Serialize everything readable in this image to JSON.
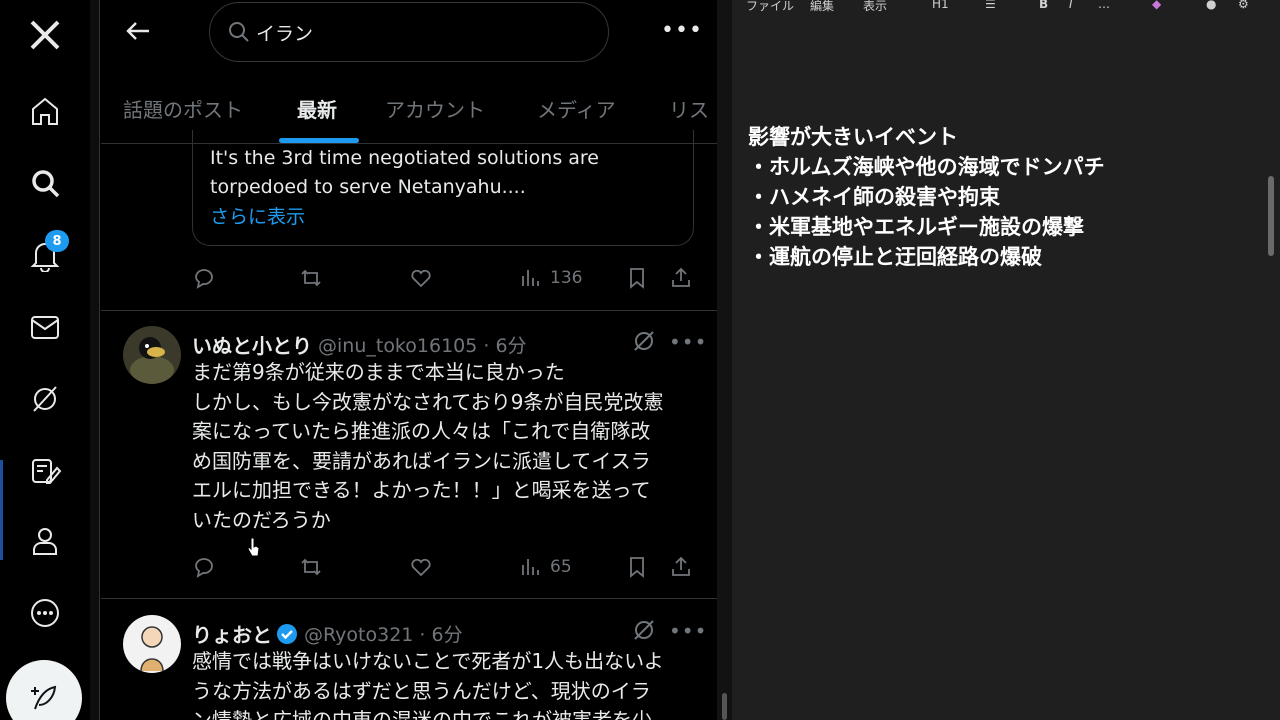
{
  "nav": {
    "notifications_badge": "8",
    "items": [
      "x-logo-icon",
      "home-icon",
      "search-icon",
      "bell-icon",
      "mail-icon",
      "grok-icon",
      "edit-icon",
      "profile-icon",
      "more-icon"
    ]
  },
  "search": {
    "value": "イラン"
  },
  "tabs": [
    "話題のポスト",
    "最新",
    "アカウント",
    "メディア",
    "リス"
  ],
  "active_tab": "最新",
  "quote": {
    "text_line1": "It's the 3rd time negotiated solutions are",
    "text_line2": "torpedoed to serve Netanyahu....",
    "more": "さらに表示",
    "views": "136"
  },
  "tweet1": {
    "name": "いぬと小とり",
    "handle": "@inu_toko16105 · 6分",
    "lines": [
      "まだ第9条が従来のままで本当に良かった",
      "しかし、もし今改憲がなされており9条が自民党改憲",
      "案になっていたら推進派の人々は「これで自衛隊改",
      "め国防軍を、要請があればイランに派遣してイスラ",
      "エルに加担できる！よかった！！」と喝采を送って",
      "いたのだろうか"
    ],
    "views": "65"
  },
  "tweet2": {
    "name": "りょおと",
    "handle": "@Ryoto321 · 6分",
    "lines": [
      "感情では戦争はいけないことで死者が1人も出ないよ",
      "うな方法があるはずだと思うんだけど、現状のイラ",
      "ン情勢と広域の中東の混迷の中でこれが被害者を少"
    ]
  },
  "editor": {
    "toolbar": [
      "ファイル",
      "編集",
      "表示",
      "H1",
      "B",
      "I",
      "…"
    ],
    "lines": [
      "影響が大きいイベント",
      "・ホルムズ海峡や他の海域でドンパチ",
      "・ハメネイ師の殺害や拘束",
      "・米軍基地やエネルギー施設の爆撃",
      "・運航の停止と迂回経路の爆破"
    ]
  }
}
